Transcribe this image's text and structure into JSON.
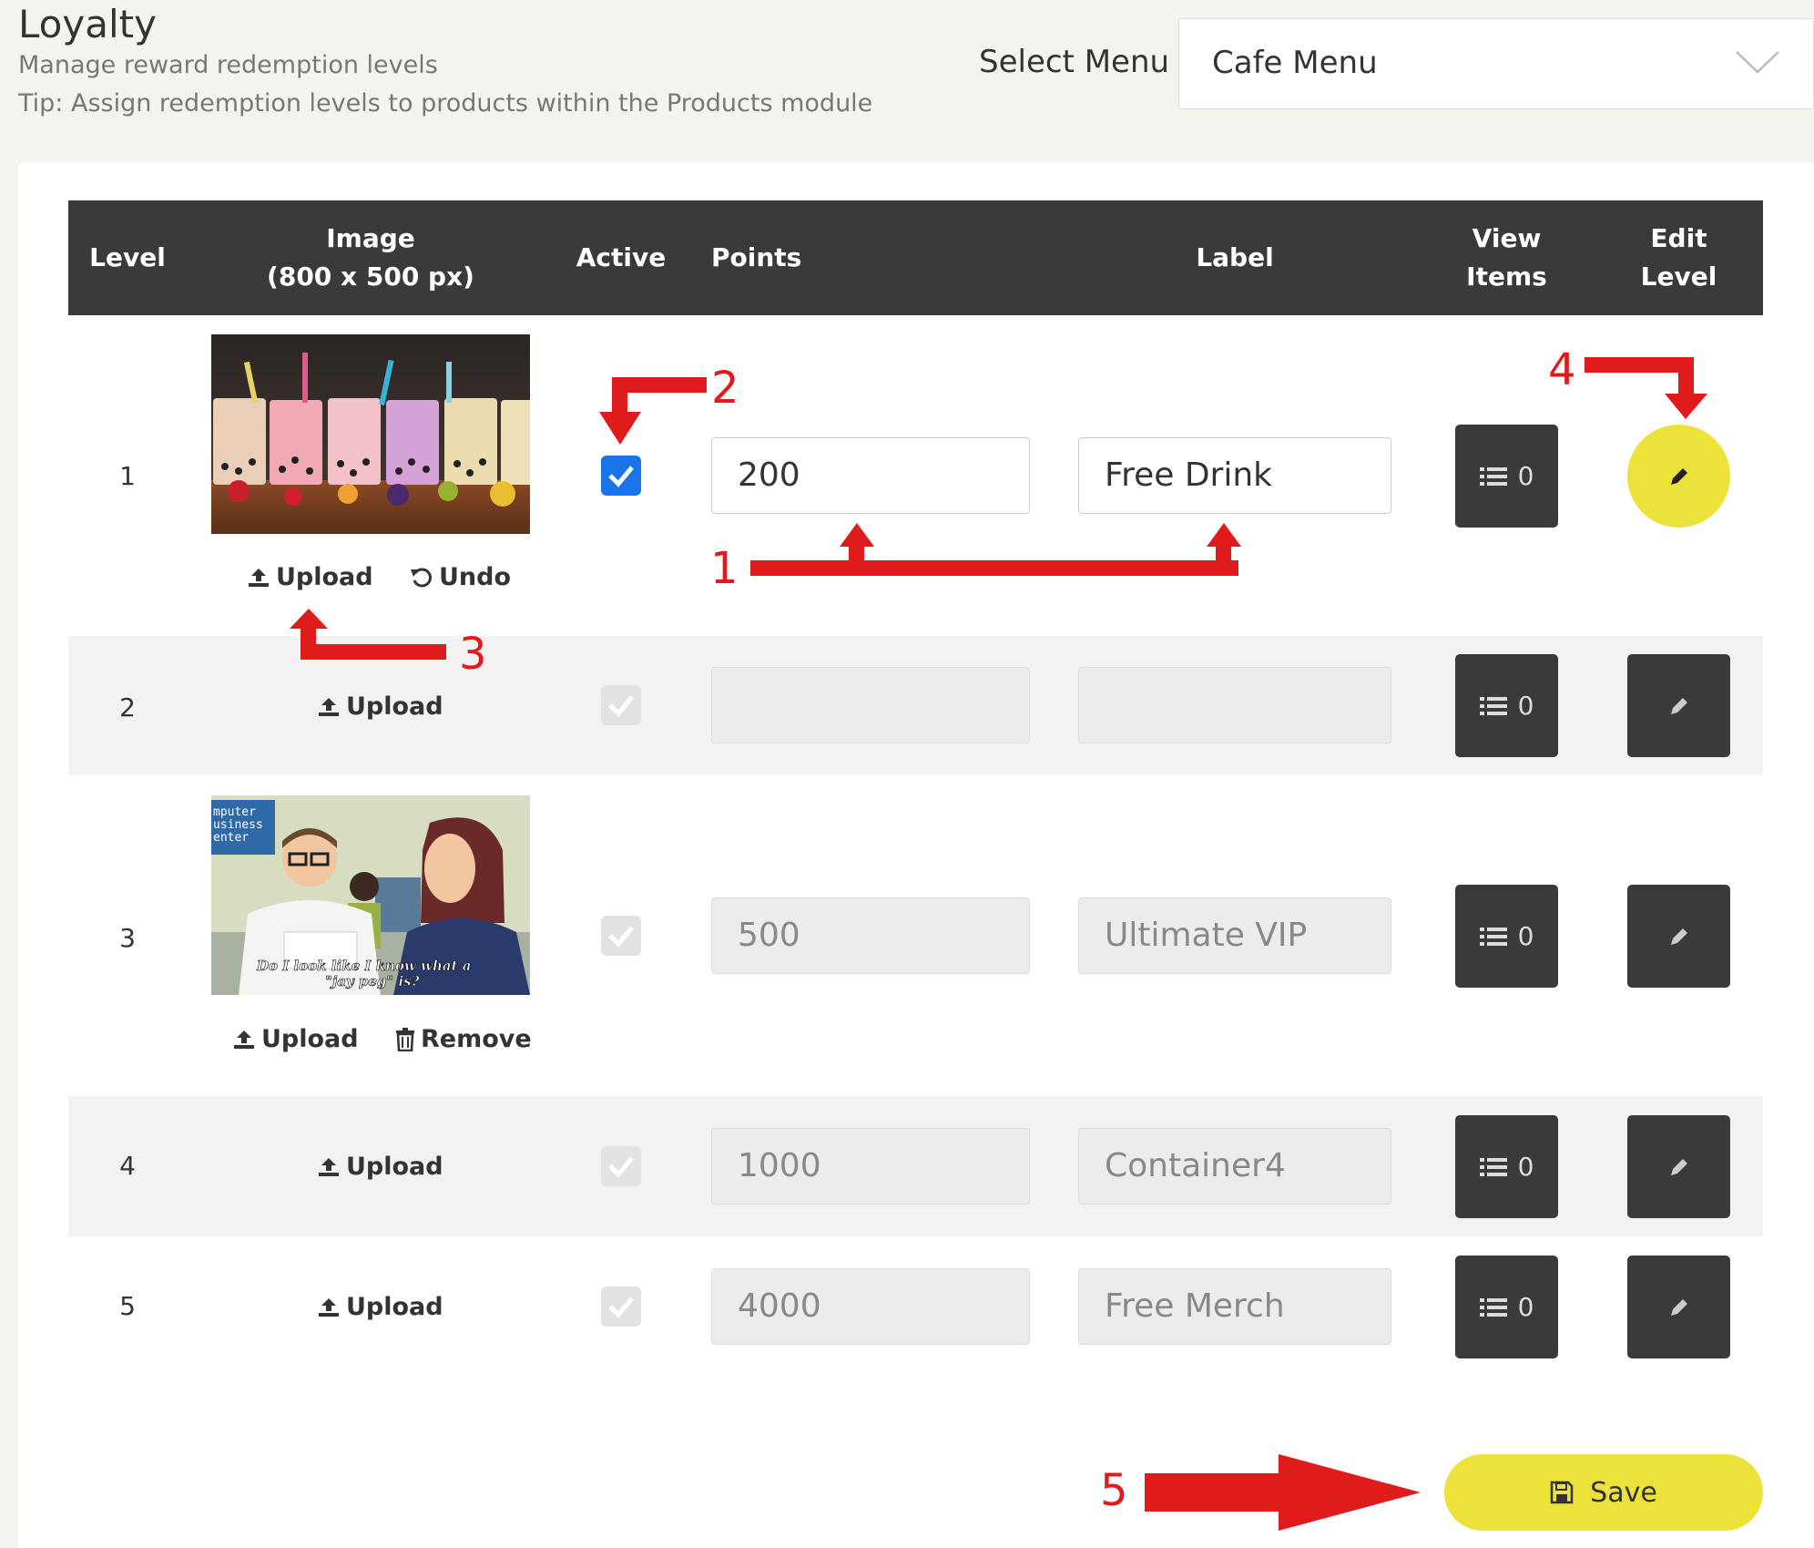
{
  "header": {
    "title": "Loyalty",
    "subtitle": "Manage reward redemption levels",
    "tip": "Tip: Assign redemption levels to products within the Products module",
    "select_label": "Select Menu",
    "selected_menu": "Cafe Menu"
  },
  "table": {
    "headers": {
      "level": "Level",
      "image_line1": "Image",
      "image_line2": "(800 x 500 px)",
      "active": "Active",
      "points": "Points",
      "label": "Label",
      "view_line1": "View",
      "view_line2": "Items",
      "edit_line1": "Edit",
      "edit_line2": "Level"
    },
    "rows": [
      {
        "level": "1",
        "image": "bubble-tea-photo",
        "actions": [
          "Upload",
          "Undo"
        ],
        "active": true,
        "editable": true,
        "points": "200",
        "label": "Free Drink",
        "item_count": "0",
        "edit_highlighted": true
      },
      {
        "level": "2",
        "image": null,
        "actions": [
          "Upload"
        ],
        "active": true,
        "editable": false,
        "points": "",
        "label": "",
        "item_count": "0",
        "edit_highlighted": false
      },
      {
        "level": "3",
        "image": "cartoon-office-photo",
        "image_caption_line1": "Do I look like I know what a",
        "image_caption_line2": "\"jay peg\" is?",
        "image_sign": "mputer usiness enter",
        "actions": [
          "Upload",
          "Remove"
        ],
        "active": true,
        "editable": false,
        "points": "500",
        "label": "Ultimate VIP",
        "item_count": "0",
        "edit_highlighted": false
      },
      {
        "level": "4",
        "image": null,
        "actions": [
          "Upload"
        ],
        "active": true,
        "editable": false,
        "points": "1000",
        "label": "Container4",
        "item_count": "0",
        "edit_highlighted": false
      },
      {
        "level": "5",
        "image": null,
        "actions": [
          "Upload"
        ],
        "active": true,
        "editable": false,
        "points": "4000",
        "label": "Free Merch",
        "item_count": "0",
        "edit_highlighted": false
      }
    ]
  },
  "save_label": "Save",
  "annotations": {
    "n1": "1",
    "n2": "2",
    "n3": "3",
    "n4": "4",
    "n5": "5",
    "color": "#e01b1b"
  },
  "colors": {
    "accent_yellow": "#ede23a",
    "header_dark": "#3a3a3a",
    "checkbox_blue": "#1a73e8"
  },
  "icons": [
    "chevron-down-icon",
    "upload-icon",
    "undo-icon",
    "trash-icon",
    "list-icon",
    "pencil-icon",
    "save-icon",
    "checkmark-icon"
  ]
}
